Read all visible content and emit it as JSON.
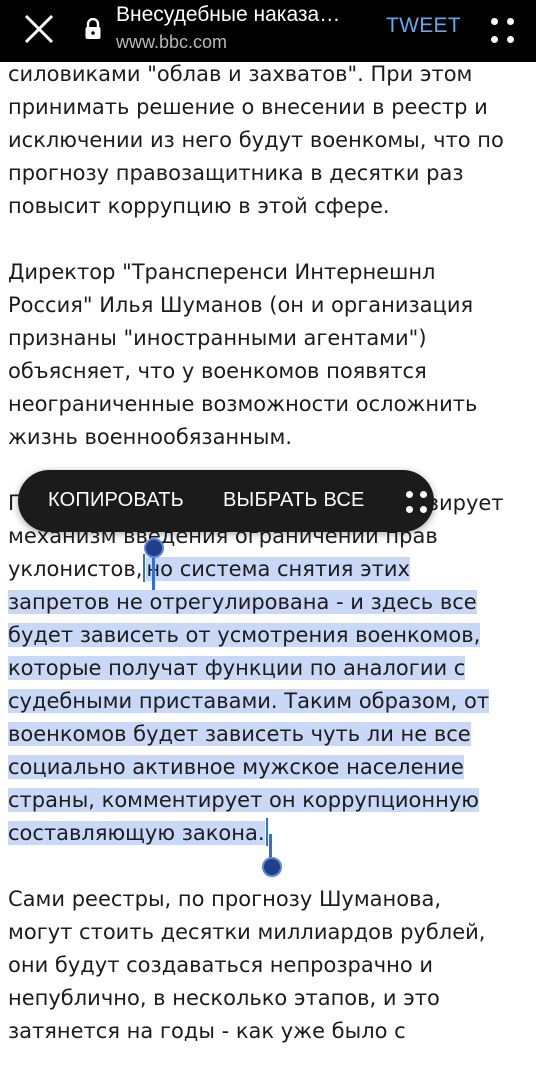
{
  "browser": {
    "title": "Внесудебные наказа…",
    "url": "www.bbc.com",
    "tweet_label": "TWEET"
  },
  "selection_toolbar": {
    "copy_label": "КОПИРОВАТЬ",
    "select_all_label": "ВЫБРАТЬ ВСЕ",
    "hidden_prefix": "П",
    "hidden_suffix": "зирует"
  },
  "article": {
    "p1": [
      "силовиками \"облав и захватов\". При этом",
      "принимать решение о внесении в реестр и",
      "исключении из него будут военкомы, что по",
      "прогнозу правозащитника в десятки раз",
      "повысит коррупцию в этой сфере."
    ],
    "p2": [
      "Директор \"Трансперенси Интернешнл",
      "Россия\" Илья Шуманов (он и организация",
      "признаны \"иностранными агентами\")",
      "объясняет, что у военкомов появятся",
      "неограниченные возможности осложнить",
      "жизнь военнообязанным."
    ],
    "p3_line2": "механизм введения ограничений прав",
    "p3_line3_unselected": "уклонистов,",
    "p3_line3_selected": "но система снятия этих",
    "p3_selected": [
      "запретов не отрегулирована - и здесь все",
      "будет зависеть от усмотрения военкомов,",
      "которые получат функции по аналогии с",
      "судебными приставами. Таким образом, от",
      "военкомов будет зависеть чуть ли не все",
      "социально активное мужское население",
      "страны, комментирует он коррупционную",
      "составляющую закона."
    ],
    "p4": [
      "Сами реестры, по прогнозу Шуманова,",
      "могут стоить десятки миллиардов рублей,",
      "они будут создаваться непрозрачно и",
      "непублично, в несколько этапов, и это",
      "затянется на годы - как уже было с"
    ]
  },
  "colors": {
    "selection": "#c9d8f7",
    "handle": "#1f3f8a",
    "tweet": "#64a8e8"
  },
  "icons": [
    "close-icon",
    "lock-icon",
    "more-vert-icon"
  ]
}
